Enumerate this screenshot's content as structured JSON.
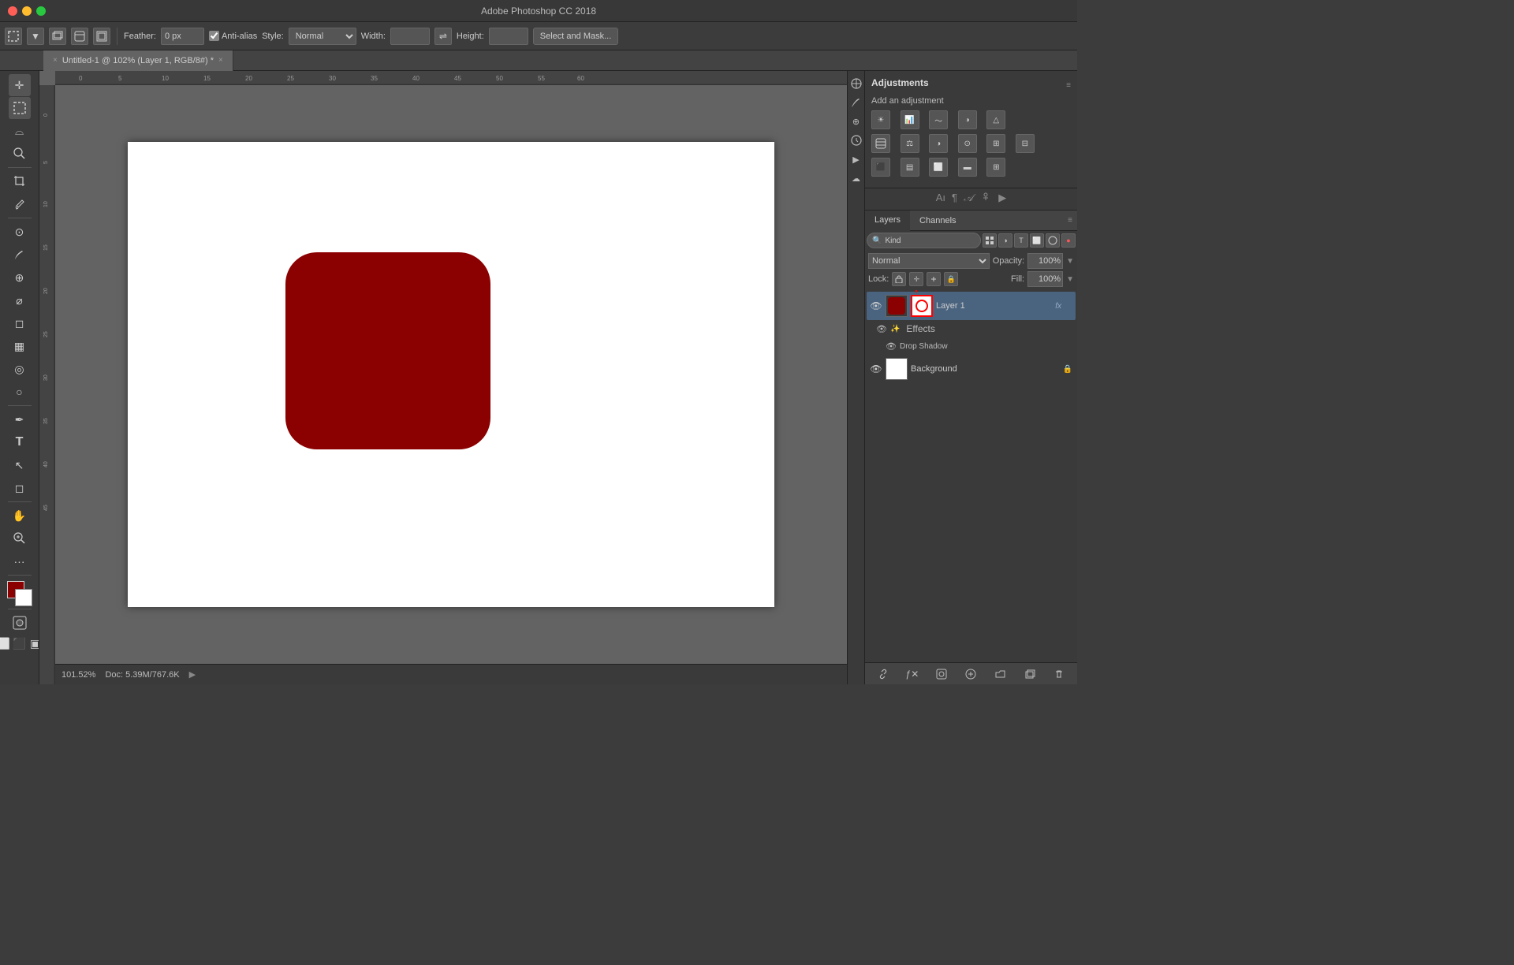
{
  "titlebar": {
    "title": "Adobe Photoshop CC 2018"
  },
  "toolbar": {
    "feather_label": "Feather:",
    "feather_value": "0 px",
    "antialias_label": "Anti-alias",
    "style_label": "Style:",
    "style_value": "Normal",
    "width_label": "Width:",
    "height_label": "Height:",
    "select_mask_btn": "Select and Mask..."
  },
  "tab": {
    "name": "Untitled-1 @ 102% (Layer 1, RGB/8#) *",
    "close": "×"
  },
  "canvas": {
    "zoom": "101.52%",
    "doc_info": "Doc: 5.39M/767.6K"
  },
  "adjustments_panel": {
    "title": "Adjustments",
    "subtitle": "Add an adjustment"
  },
  "layers_panel": {
    "tab_layers": "Layers",
    "tab_channels": "Channels",
    "kind_label": "Kind",
    "normal_label": "Normal",
    "opacity_label": "Opacity:",
    "opacity_value": "100%",
    "lock_label": "Lock:",
    "fill_label": "Fill:",
    "fill_value": "100%",
    "layer1_name": "Layer 1",
    "layer1_fx": "fx",
    "effects_label": "Effects",
    "drop_shadow_label": "Drop Shadow",
    "background_name": "Background"
  },
  "status": {
    "zoom": "101.52%",
    "doc": "Doc: 5.39M/767.6K"
  }
}
